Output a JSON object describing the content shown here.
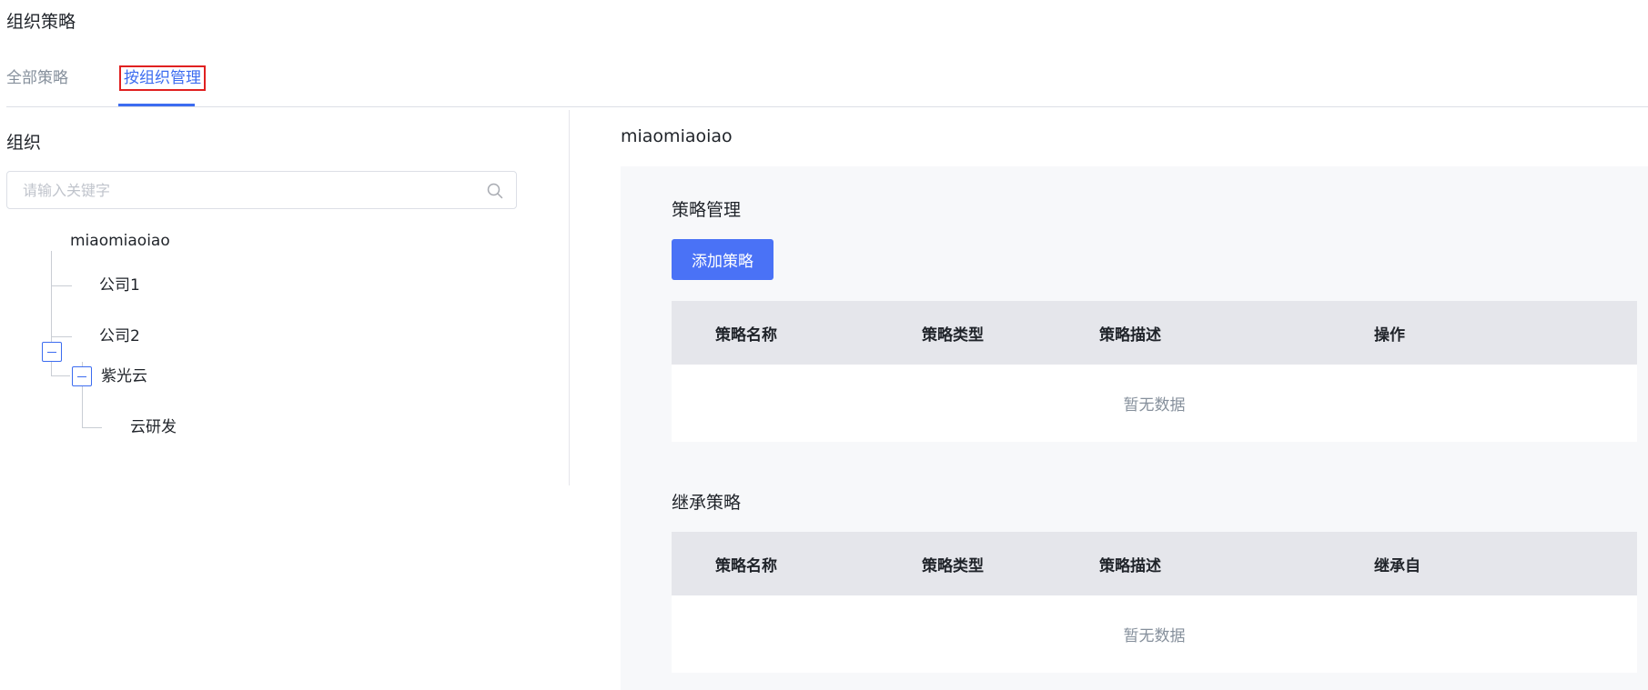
{
  "page_title": "组织策略",
  "tabs": [
    {
      "label": "全部策略",
      "active": false
    },
    {
      "label": "按组织管理",
      "active": true
    }
  ],
  "left": {
    "heading": "组织",
    "search_placeholder": "请输入关键字",
    "tree": {
      "root": "miaomiaoiao",
      "children": [
        "公司1",
        "公司2",
        "紫光云"
      ],
      "grandchildren": [
        "云研发"
      ]
    }
  },
  "right": {
    "org_name": "miaomiaoiao",
    "policy_section": {
      "title": "策略管理",
      "add_button": "添加策略",
      "columns": [
        "策略名称",
        "策略类型",
        "策略描述",
        "操作"
      ],
      "empty_text": "暂无数据"
    },
    "inherit_section": {
      "title": "继承策略",
      "columns": [
        "策略名称",
        "策略类型",
        "策略描述",
        "继承自"
      ],
      "empty_text": "暂无数据"
    }
  },
  "colors": {
    "primary": "#4a72f6",
    "tab_active": "#3c6cf0",
    "highlight_border": "#e02020",
    "panel_bg": "#f7f8fa",
    "table_header_bg": "#e5e6eb"
  },
  "icons": {
    "search": "search-icon",
    "collapse": "minus-square-icon"
  }
}
